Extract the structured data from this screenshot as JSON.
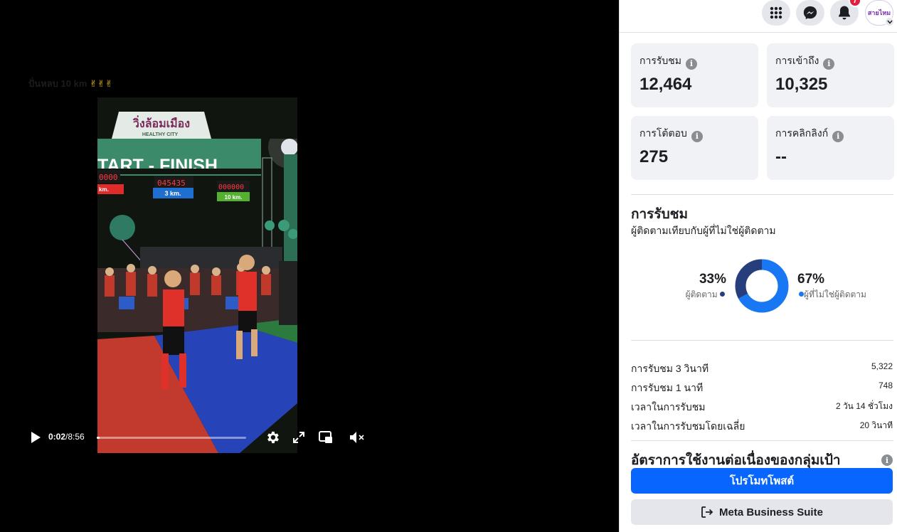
{
  "video": {
    "caption_text": "ปั่นหลบ 10 km",
    "caption_emoji": "✌✌✌",
    "scene": {
      "arch_brand": "วิ่งล้อมเมือง",
      "arch_sub": "HEALTHY CITY",
      "arch_text": "TART - FINISH",
      "clock_left": "0000",
      "clock_mid": "045435",
      "clock_right": "000000",
      "dist_left": "km.",
      "dist_mid": "3 km.",
      "dist_right": "10 km."
    },
    "time_current": "0:02",
    "time_separator": " / ",
    "time_total": "8:56",
    "progress_fraction": 0.004
  },
  "topbar": {
    "notifications_count": "7",
    "avatar_text": "สายไหม"
  },
  "metrics": [
    {
      "label": "การรับชม",
      "value": "12,464"
    },
    {
      "label": "การเข้าถึง",
      "value": "10,325"
    },
    {
      "label": "การโต้ตอบ",
      "value": "275"
    },
    {
      "label": "การคลิกลิงก์",
      "value": "--"
    }
  ],
  "views_section": {
    "title": "การรับชม",
    "subtitle": "ผู้ติดตามเทียบกับผู้ที่ไม่ใช่ผู้ติดตาม",
    "followers_pct": "33%",
    "followers_label": "ผู้ติดตาม",
    "non_followers_pct": "67%",
    "non_followers_label": "ผู้ที่ไม่ใช่ผู้ติดตาม"
  },
  "chart_data": {
    "type": "pie",
    "categories": [
      "ผู้ติดตาม",
      "ผู้ที่ไม่ใช่ผู้ติดตาม"
    ],
    "values": [
      33,
      67
    ],
    "colors": [
      "#263e7c",
      "#1877f2"
    ]
  },
  "stats": [
    {
      "label": "การรับชม 3 วินาที",
      "value": "5,322"
    },
    {
      "label": "การรับชม 1 นาที",
      "value": "748"
    },
    {
      "label": "เวลาในการรับชม",
      "value": "2 วัน 14 ชั่วโมง"
    },
    {
      "label": "เวลาในการรับชมโดยเฉลี่ย",
      "value": "20 วินาที"
    }
  ],
  "retention": {
    "title": "อัตราการใช้งานต่อเนื่องของกลุ่มเป้า"
  },
  "buttons": {
    "promote": "โปรโมทโพสต์",
    "business_suite": "Meta Business Suite"
  },
  "colors": {
    "accent": "#0866ff",
    "followers": "#263e7c",
    "non_followers": "#1877f2",
    "badge": "#e41e3f"
  }
}
